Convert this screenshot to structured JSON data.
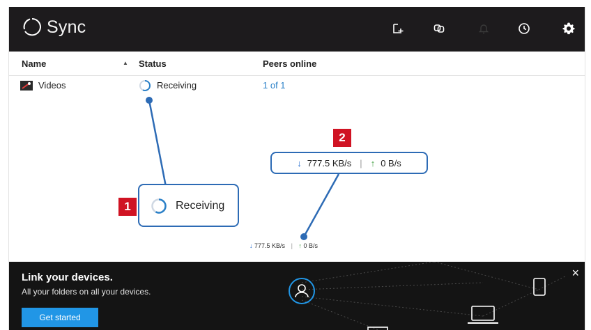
{
  "app": {
    "title": "Sync"
  },
  "toolbar": {
    "icons": [
      "add-folder-icon",
      "link-icon",
      "notifications-icon",
      "history-icon",
      "gear-icon"
    ]
  },
  "table": {
    "columns": {
      "name": "Name",
      "status": "Status",
      "peers": "Peers online"
    },
    "rows": [
      {
        "name": "Videos",
        "status": "Receiving",
        "peers": "1 of 1"
      }
    ]
  },
  "transfer": {
    "down": "777.5 KB/s",
    "up": "0 B/s"
  },
  "callouts": {
    "one": {
      "number": "1",
      "status": "Receiving"
    },
    "two": {
      "number": "2",
      "down": "777.5 KB/s",
      "up": "0 B/s"
    }
  },
  "banner": {
    "title": "Link your devices.",
    "subtitle": "All your folders on all your devices.",
    "button": "Get started",
    "close": "×"
  },
  "colors": {
    "accent": "#2196e6",
    "topbar": "#1d1b1d",
    "callout_border": "#2d6bb5",
    "tag": "#d01323"
  }
}
